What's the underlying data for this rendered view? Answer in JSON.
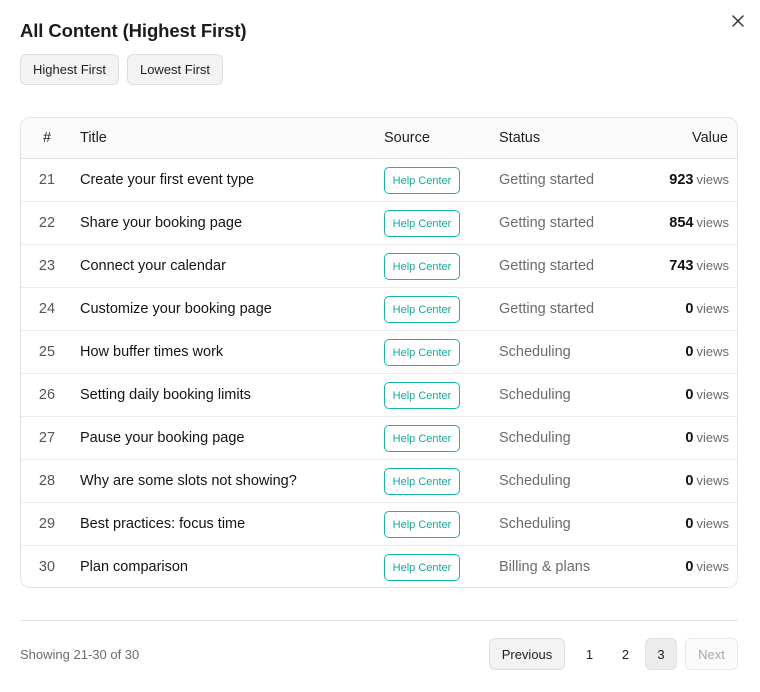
{
  "modal": {
    "title": "All Content (Highest First)"
  },
  "sort": {
    "highest_label": "Highest First",
    "lowest_label": "Lowest First"
  },
  "table": {
    "headers": {
      "num": "#",
      "title": "Title",
      "source": "Source",
      "status": "Status",
      "value": "Value"
    },
    "value_unit": "views",
    "rows": [
      {
        "num": "21",
        "title": "Create your first event type",
        "source": "Help Center",
        "status": "Getting started",
        "value": "923"
      },
      {
        "num": "22",
        "title": "Share your booking page",
        "source": "Help Center",
        "status": "Getting started",
        "value": "854"
      },
      {
        "num": "23",
        "title": "Connect your calendar",
        "source": "Help Center",
        "status": "Getting started",
        "value": "743"
      },
      {
        "num": "24",
        "title": "Customize your booking page",
        "source": "Help Center",
        "status": "Getting started",
        "value": "0"
      },
      {
        "num": "25",
        "title": "How buffer times work",
        "source": "Help Center",
        "status": "Scheduling",
        "value": "0"
      },
      {
        "num": "26",
        "title": "Setting daily booking limits",
        "source": "Help Center",
        "status": "Scheduling",
        "value": "0"
      },
      {
        "num": "27",
        "title": "Pause your booking page",
        "source": "Help Center",
        "status": "Scheduling",
        "value": "0"
      },
      {
        "num": "28",
        "title": "Why are some slots not showing?",
        "source": "Help Center",
        "status": "Scheduling",
        "value": "0"
      },
      {
        "num": "29",
        "title": "Best practices: focus time",
        "source": "Help Center",
        "status": "Scheduling",
        "value": "0"
      },
      {
        "num": "30",
        "title": "Plan comparison",
        "source": "Help Center",
        "status": "Billing & plans",
        "value": "0"
      }
    ]
  },
  "footer": {
    "showing": "Showing 21-30 of 30",
    "previous_label": "Previous",
    "next_label": "Next",
    "pages": [
      "1",
      "2",
      "3"
    ],
    "current_page": "3"
  },
  "colors": {
    "badge_accent": "#1bb5a8",
    "border": "#e4e4e4"
  },
  "icons": {
    "close": "close-icon"
  }
}
